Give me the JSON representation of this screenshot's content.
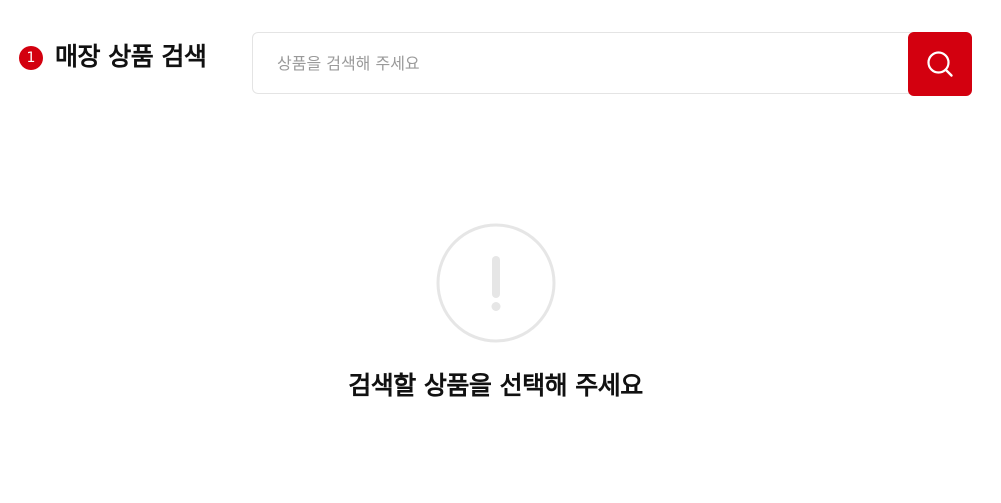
{
  "header": {
    "step_number": "1",
    "title": "매장 상품 검색"
  },
  "search": {
    "placeholder": "상품을 검색해 주세요",
    "value": "",
    "button_icon": "search-icon"
  },
  "empty_state": {
    "icon": "exclamation-circle-icon",
    "message": "검색할 상품을 선택해 주세요"
  },
  "colors": {
    "accent": "#d3000f",
    "border": "#e4e4e4",
    "icon_gray": "#e6e6e6",
    "text": "#111111",
    "placeholder": "#9a9a9a"
  }
}
